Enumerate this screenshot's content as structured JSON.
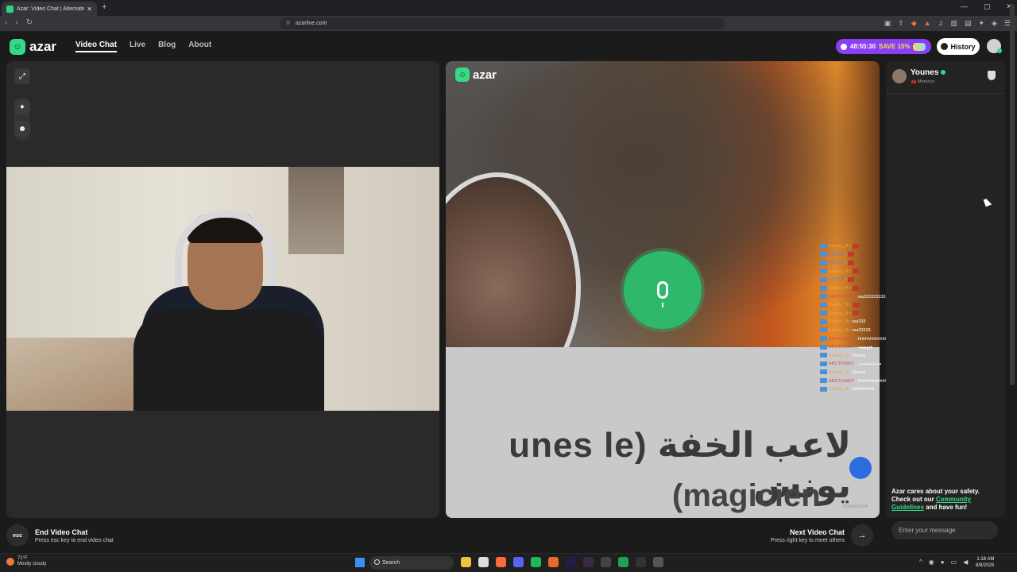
{
  "browser": {
    "tab_title": "Azar: Video Chat | Alternative",
    "url": "azarlive.com"
  },
  "header": {
    "logo_text": "azar",
    "nav": [
      {
        "label": "Video Chat",
        "active": true
      },
      {
        "label": "Live",
        "active": false
      },
      {
        "label": "Blog",
        "active": false
      },
      {
        "label": "About",
        "active": false
      }
    ],
    "promo_timer": "48:55:30",
    "promo_save": "SAVE 15%",
    "history_label": "History"
  },
  "stranger_video": {
    "logo_text": "azar",
    "banner_line1": "unes le) لاعب الخفة يونس",
    "banner_line2": "(magicien",
    "watermark": "tictades334"
  },
  "chat_overlay": [
    {
      "user": "Kaneki_2k",
      "style": "u1",
      "text": ""
    },
    {
      "user": "Fcl0010",
      "style": "u2",
      "text": ""
    },
    {
      "user": "Fcl0010",
      "style": "u2",
      "text": ""
    },
    {
      "user": "Kaneki_2k",
      "style": "u1",
      "text": ""
    },
    {
      "user": "Fcl0010",
      "style": "u2",
      "text": ""
    },
    {
      "user": "Kaneki_2k",
      "style": "u1",
      "text": ""
    },
    {
      "user": "ARCTIUMXY",
      "style": "u3",
      "text": "wa333333333333333 7wak"
    },
    {
      "user": "Kaneki_2k",
      "style": "u1",
      "text": ""
    },
    {
      "user": "Kaneki_2k",
      "style": "u1",
      "text": ""
    },
    {
      "user": "Kaneki_2k",
      "style": "u1",
      "text": "wa333"
    },
    {
      "user": "Kaneki_2k",
      "style": "u1",
      "text": "wa33333"
    },
    {
      "user": "ARCTIUMXY",
      "style": "u3",
      "text": "hhhhhhhhhhhhhhhhhhhhhhh"
    },
    {
      "user": "ARCTIUMXY",
      "style": "u3",
      "text": "ههههههه"
    },
    {
      "user": "Kaneki_2k",
      "style": "u1",
      "text": "l3oinat"
    },
    {
      "user": "ARCTIUMXY",
      "style": "u3",
      "text": "مششششش"
    },
    {
      "user": "Kaneki_2k",
      "style": "u1",
      "text": "l3oinat"
    },
    {
      "user": "ARCTIUMXY",
      "style": "u3",
      "text": "hhhhhhhhhhhhhhhhhhhhhhhhhhhhhhhhhhhhhhhhhhhh"
    },
    {
      "user": "Kaneki_2k",
      "style": "u1",
      "text": "hhhhhhhhh"
    }
  ],
  "partner": {
    "name": "Younes",
    "country": "Morocco"
  },
  "safety": {
    "text_before": "Azar cares about your safety. Check out our ",
    "link": "Community Guidelines",
    "text_after": " and have fun!"
  },
  "bottom": {
    "esc_label": "esc",
    "end_title": "End Video Chat",
    "end_sub": "Press esc key to end video chat",
    "next_title": "Next Video Chat",
    "next_sub": "Press right key to meet others",
    "message_placeholder": "Enter your message"
  },
  "taskbar": {
    "temp": "71°F",
    "weather": "Mostly cloudy",
    "search_label": "Search",
    "time": "1:18 AM",
    "date": "8/8/2025"
  },
  "colors": {
    "accent_green": "#36d986",
    "promo_purple": "#8a3ff2",
    "mic_green": "#2eb86a"
  }
}
